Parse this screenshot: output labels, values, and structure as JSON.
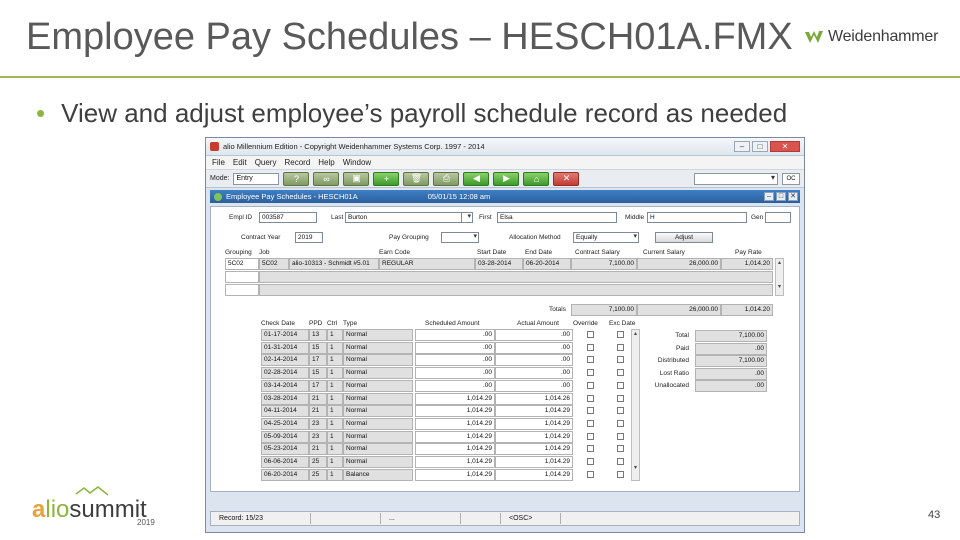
{
  "slide": {
    "title": "Employee Pay Schedules – HESCH01A.FMX",
    "brand": "Weidenhammer",
    "bullet": "View and adjust employee’s payroll schedule record as needed",
    "footer_logo_a": "a",
    "footer_logo_rest": "lio",
    "footer_logo_word": "summit",
    "footer_year": "2019",
    "page_number": "43"
  },
  "colors": {
    "accent_green": "#9bbb59",
    "form_title_blue": "#2a5f9e"
  },
  "window": {
    "title": "alio Millennium Edition - Copyright Weidenhammer Systems Corp. 1997 - 2014",
    "menu": [
      "File",
      "Edit",
      "Query",
      "Record",
      "Help",
      "Window"
    ],
    "mode_label": "Mode:",
    "mode_value": "Entry",
    "toolbar_icons": [
      "help-icon",
      "binoculars-icon",
      "save-icon",
      "add-icon",
      "delete-icon",
      "print-icon",
      "back-arrow-icon",
      "forward-arrow-icon",
      "home-icon",
      "exit-icon"
    ],
    "toolbar_small": "OC"
  },
  "form": {
    "title": "Employee Pay Schedules - HESCH01A",
    "timestamp": "05/01/15  12:08 am",
    "labels": {
      "empl_id": "Empl ID",
      "last": "Last",
      "first": "First",
      "middle": "Middle",
      "gen": "Gen",
      "contract_year": "Contract Year",
      "pay_grouping": "Pay Grouping",
      "allocation_method": "Allocation Method"
    },
    "values": {
      "empl_id": "003587",
      "last": "Burton",
      "first": "Elsa",
      "middle": "H",
      "gen": "",
      "contract_year": "2019",
      "pay_grouping": "",
      "allocation_method": "Equally"
    },
    "adjust_button": "Adjust"
  },
  "contract_grid": {
    "headers": [
      "Grouping",
      "Job",
      "Earn Code",
      "Start Date",
      "End Date",
      "Contract Salary",
      "Current Salary",
      "Pay Rate"
    ],
    "rows": [
      [
        "5C02",
        "5C02",
        "alio-10313 - Schmidt #5.01",
        "REGULAR",
        "03-28-2014",
        "06-20-2014",
        "7,100.00",
        "26,000.00",
        "1,014.20"
      ]
    ],
    "totals_label": "Totals",
    "totals": [
      "7,100.00",
      "26,000.00",
      "1,014.20"
    ]
  },
  "schedule_grid": {
    "headers": [
      "Check Date",
      "PPD",
      "Ctrl",
      "Type",
      "Scheduled Amount",
      "Actual Amount",
      "Override",
      "Exc Date"
    ],
    "rows": [
      [
        "01-17-2014",
        "13",
        "1",
        "Normal",
        ".00",
        ".00"
      ],
      [
        "01-31-2014",
        "15",
        "1",
        "Normal",
        ".00",
        ".00"
      ],
      [
        "02-14-2014",
        "17",
        "1",
        "Normal",
        ".00",
        ".00"
      ],
      [
        "02-28-2014",
        "15",
        "1",
        "Normal",
        ".00",
        ".00"
      ],
      [
        "03-14-2014",
        "17",
        "1",
        "Normal",
        ".00",
        ".00"
      ],
      [
        "03-28-2014",
        "21",
        "1",
        "Normal",
        "1,014.29",
        "1,014.26"
      ],
      [
        "04-11-2014",
        "21",
        "1",
        "Normal",
        "1,014.29",
        "1,014.29"
      ],
      [
        "04-25-2014",
        "23",
        "1",
        "Normal",
        "1,014.29",
        "1,014.29"
      ],
      [
        "05-09-2014",
        "23",
        "1",
        "Normal",
        "1,014.29",
        "1,014.29"
      ],
      [
        "05-23-2014",
        "21",
        "1",
        "Normal",
        "1,014.29",
        "1,014.29"
      ],
      [
        "06-06-2014",
        "25",
        "1",
        "Normal",
        "1,014.29",
        "1,014.29"
      ],
      [
        "06-20-2014",
        "25",
        "1",
        "Balance",
        "1,014.29",
        "1,014.29"
      ]
    ]
  },
  "summary": {
    "labels": [
      "Total",
      "Paid",
      "Distributed",
      "Lost Ratio",
      "Unallocated"
    ],
    "values": [
      "7,100.00",
      ".00",
      "7,100.00",
      ".00",
      ".00"
    ]
  },
  "status_bar": {
    "record": "Record: 15/23",
    "sep": "...",
    "osc": "<OSC>"
  }
}
